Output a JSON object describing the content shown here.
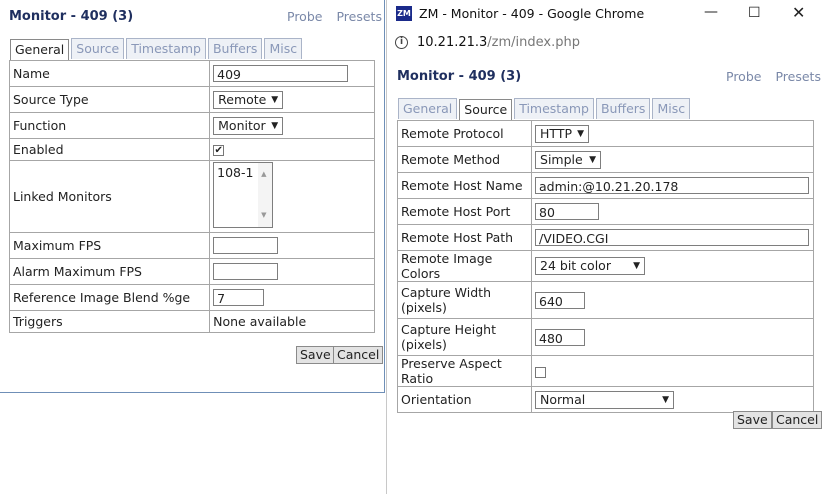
{
  "left": {
    "title": "Monitor - 409 (3)",
    "links": [
      "Probe",
      "Presets"
    ],
    "tabs": [
      "General",
      "Source",
      "Timestamp",
      "Buffers",
      "Misc"
    ],
    "active_tab": "General",
    "rows": {
      "name": {
        "label": "Name",
        "value": "409"
      },
      "source_type": {
        "label": "Source Type",
        "value": "Remote"
      },
      "function": {
        "label": "Function",
        "value": "Monitor"
      },
      "enabled": {
        "label": "Enabled",
        "checked": "✔"
      },
      "linked": {
        "label": "Linked Monitors",
        "item": "108-1"
      },
      "max_fps": {
        "label": "Maximum FPS",
        "value": ""
      },
      "alarm_fps": {
        "label": "Alarm Maximum FPS",
        "value": ""
      },
      "blend": {
        "label": "Reference Image Blend %ge",
        "value": "7"
      },
      "triggers": {
        "label": "Triggers",
        "value": "None available"
      }
    },
    "save": "Save",
    "cancel": "Cancel"
  },
  "right": {
    "window_title": "ZM - Monitor - 409 - Google Chrome",
    "logo_text": "ZM",
    "url_host": "10.21.21.3",
    "url_path": "/zm/index.php",
    "title": "Monitor - 409 (3)",
    "links": [
      "Probe",
      "Presets"
    ],
    "tabs": [
      "General",
      "Source",
      "Timestamp",
      "Buffers",
      "Misc"
    ],
    "active_tab": "Source",
    "rows": {
      "protocol": {
        "label": "Remote Protocol",
        "value": "HTTP"
      },
      "method": {
        "label": "Remote Method",
        "value": "Simple"
      },
      "host_name": {
        "label": "Remote Host Name",
        "value": "admin:@10.21.20.178"
      },
      "host_port": {
        "label": "Remote Host Port",
        "value": "80"
      },
      "host_path": {
        "label": "Remote Host Path",
        "value": "/VIDEO.CGI"
      },
      "colors": {
        "label": "Remote Image Colors",
        "value": "24 bit color"
      },
      "cap_width": {
        "label": "Capture Width",
        "sub": "(pixels)",
        "value": "640"
      },
      "cap_height": {
        "label": "Capture Height",
        "sub": "(pixels)",
        "value": "480"
      },
      "aspect": {
        "label": "Preserve Aspect Ratio",
        "checked": ""
      },
      "orientation": {
        "label": "Orientation",
        "value": "Normal"
      }
    },
    "save": "Save",
    "cancel": "Cancel"
  }
}
